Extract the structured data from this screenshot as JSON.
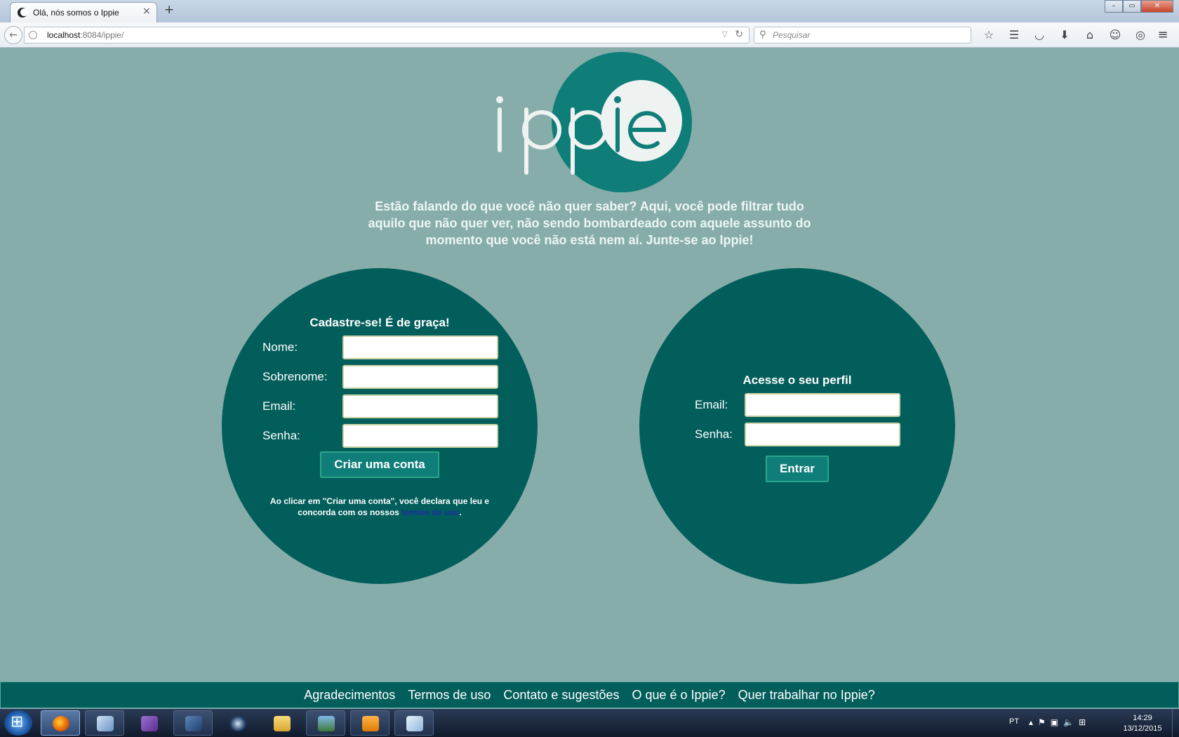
{
  "browser": {
    "tab_title": "Olá, nós somos o Ippie",
    "tab_close": "×",
    "new_tab": "+",
    "url_host": "localhost",
    "url_rest": ":8084/ippie/",
    "search_placeholder": "Pesquisar",
    "window_buttons": {
      "minimize": "–",
      "maximize": "▭",
      "close": "✕"
    }
  },
  "page": {
    "logo_text": "ippie",
    "tagline": "Estão falando do que você não quer saber? Aqui, você pode filtrar tudo aquilo que não quer ver, não sendo bombardeado com aquele assunto do momento que você não está nem aí. Junte-se ao Ippie!",
    "signup": {
      "title": "Cadastre-se! É de graça!",
      "fields": [
        "Nome:",
        "Sobrenome:",
        "Email:",
        "Senha:"
      ],
      "button": "Criar uma conta",
      "terms_before": "Ao clicar em \"Criar uma conta\", você declara que leu e concorda com os nossos ",
      "terms_link": "termos de uso",
      "terms_after": "."
    },
    "login": {
      "title": "Acesse o seu perfil",
      "fields": [
        "Email:",
        "Senha:"
      ],
      "button": "Entrar"
    },
    "footer_links": [
      "Agradecimentos",
      "Termos de uso",
      "Contato e sugestões",
      "O que é o Ippie?",
      "Quer trabalhar no Ippie?"
    ]
  },
  "taskbar": {
    "language": "PT",
    "time": "14:29",
    "date": "13/12/2015",
    "apps": [
      "firefox-icon",
      "virtualbox-icon",
      "visual-studio-icon",
      "mysql-workbench-icon",
      "steam-icon",
      "file-explorer-icon",
      "image-viewer-icon",
      "media-player-icon",
      "notepad-icon"
    ]
  },
  "colors": {
    "page_background": "#86adaa",
    "circle": "#025e5b",
    "button": "#0f7d78",
    "button_border": "#2ba58a",
    "terms_link": "#1a2fa3"
  }
}
